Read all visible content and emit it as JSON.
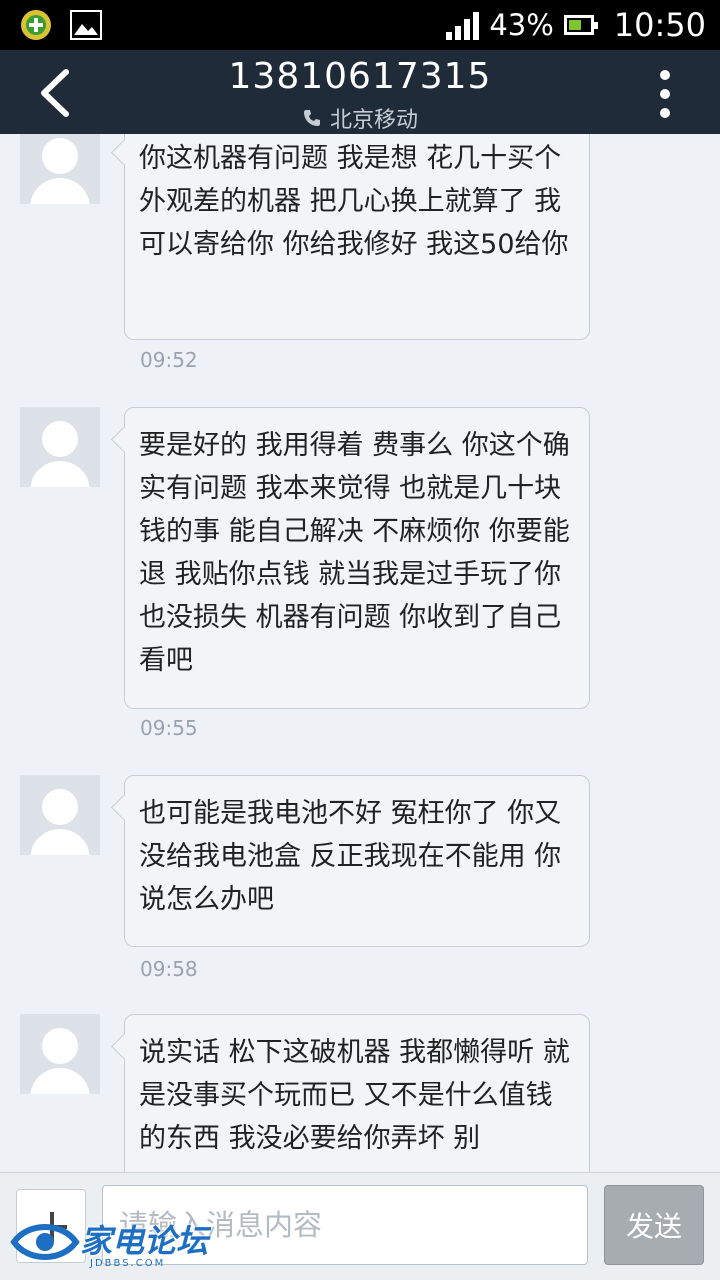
{
  "status_bar": {
    "battery": "43%",
    "time": "10:50"
  },
  "header": {
    "phone_number": "13810617315",
    "carrier": "北京移动"
  },
  "messages": [
    {
      "text": "你这机器有问题 我是想 花几十买个外观差的机器 把几心换上就算了 我可以寄给你 你给我修好 我这50给你",
      "time": "09:52"
    },
    {
      "text": "要是好的 我用得着 费事么 你这个确实有问题 我本来觉得 也就是几十块钱的事 能自己解决 不麻烦你 你要能退 我贴你点钱 就当我是过手玩了你也没损失 机器有问题 你收到了自己看吧",
      "time": "09:55"
    },
    {
      "text": "也可能是我电池不好 冤枉你了 你又没给我电池盒 反正我现在不能用 你说怎么办吧",
      "time": "09:58"
    },
    {
      "text": "说实话 松下这破机器 我都懒得听 就是没事买个玩而已 又不是什么值钱的东西 我没必要给你弄坏 别",
      "time": ""
    }
  ],
  "input": {
    "placeholder": "请输入消息内容",
    "send_label": "发送"
  },
  "watermark": {
    "text": "家电论坛",
    "sub": "JDBBS.COM"
  }
}
